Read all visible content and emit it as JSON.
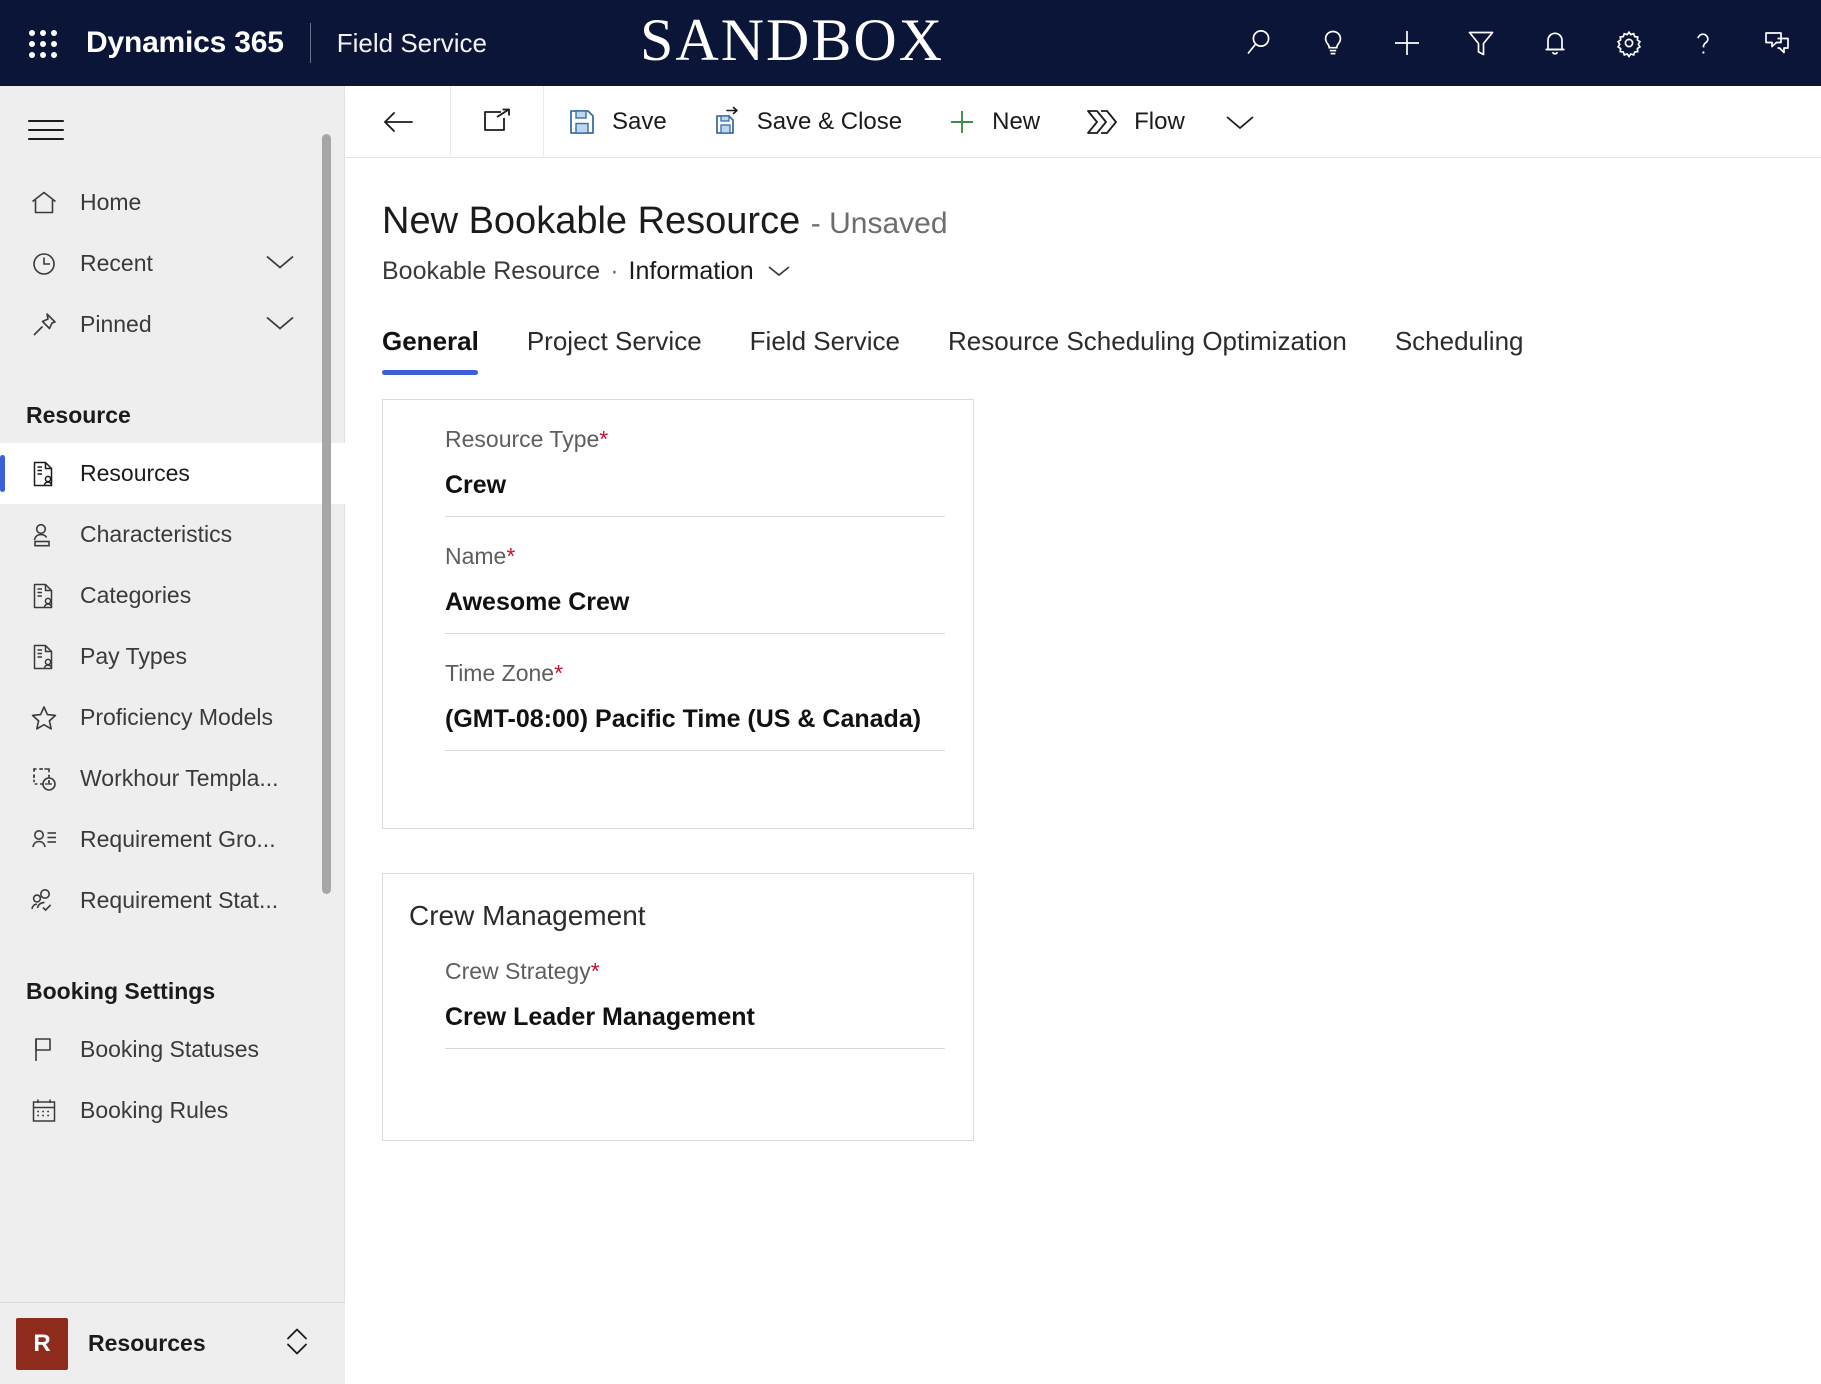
{
  "topbar": {
    "waffle_icon": "app-launcher-icon",
    "brand": "Dynamics 365",
    "app_name": "Field Service",
    "environment_banner": "SANDBOX",
    "icons": [
      {
        "name": "search-icon",
        "label": "Search"
      },
      {
        "name": "lightbulb-icon",
        "label": "Ideas"
      },
      {
        "name": "plus-icon",
        "label": "Quick create"
      },
      {
        "name": "filter-icon",
        "label": "Filter"
      },
      {
        "name": "bell-icon",
        "label": "Notifications"
      },
      {
        "name": "gear-icon",
        "label": "Settings"
      },
      {
        "name": "question-icon",
        "label": "Help"
      },
      {
        "name": "feedback-icon",
        "label": "Feedback"
      }
    ]
  },
  "sidebar": {
    "hamburger_label": "Site map",
    "items": [
      {
        "label": "Home",
        "icon": "home-icon",
        "chevron": false,
        "selected": false
      },
      {
        "label": "Recent",
        "icon": "clock-icon",
        "chevron": true,
        "selected": false
      },
      {
        "label": "Pinned",
        "icon": "pin-icon",
        "chevron": true,
        "selected": false
      }
    ],
    "groups": [
      {
        "header": "Resource",
        "items": [
          {
            "label": "Resources",
            "icon": "resource-card-icon",
            "selected": true
          },
          {
            "label": "Characteristics",
            "icon": "person-line-icon",
            "selected": false
          },
          {
            "label": "Categories",
            "icon": "resource-card-icon",
            "selected": false
          },
          {
            "label": "Pay Types",
            "icon": "resource-card-icon",
            "selected": false
          },
          {
            "label": "Proficiency Models",
            "icon": "star-icon",
            "selected": false
          },
          {
            "label": "Workhour Templa...",
            "icon": "workhour-clock-icon",
            "selected": false
          },
          {
            "label": "Requirement Gro...",
            "icon": "person-list-icon",
            "selected": false
          },
          {
            "label": "Requirement Stat...",
            "icon": "people-check-icon",
            "selected": false
          }
        ]
      },
      {
        "header": "Booking Settings",
        "items": [
          {
            "label": "Booking Statuses",
            "icon": "flag-icon",
            "selected": false
          },
          {
            "label": "Booking Rules",
            "icon": "calendar-icon",
            "selected": false
          }
        ]
      }
    ],
    "area_switcher": {
      "badge": "R",
      "label": "Resources",
      "badge_color": "#8f2b1d",
      "chevron_icon": "chevron-up-down-icon"
    }
  },
  "command_bar": {
    "back_label": "Back",
    "popout_label": "Open in new window",
    "buttons": [
      {
        "label": "Save",
        "icon": "save-floppy-icon"
      },
      {
        "label": "Save & Close",
        "icon": "save-close-icon"
      },
      {
        "label": "New",
        "icon": "plus-green-icon"
      },
      {
        "label": "Flow",
        "icon": "flow-icon"
      }
    ],
    "overflow_label": "More commands",
    "overflow_icon": "chevron-down-icon"
  },
  "form": {
    "title": "New Bookable Resource",
    "title_status": "- Unsaved",
    "breadcrumb_entity": "Bookable Resource",
    "breadcrumb_separator": "·",
    "breadcrumb_form": "Information",
    "breadcrumb_chevron": "chevron-down-icon",
    "tabs": [
      {
        "label": "General",
        "active": true
      },
      {
        "label": "Project Service",
        "active": false
      },
      {
        "label": "Field Service",
        "active": false
      },
      {
        "label": "Resource Scheduling Optimization",
        "active": false
      },
      {
        "label": "Scheduling",
        "active": false
      }
    ],
    "sections": [
      {
        "title": "",
        "fields": [
          {
            "label": "Resource Type",
            "required": true,
            "value": "Crew"
          },
          {
            "label": "Name",
            "required": true,
            "value": "Awesome Crew"
          },
          {
            "label": "Time Zone",
            "required": true,
            "value": "(GMT-08:00) Pacific Time (US & Canada)"
          }
        ]
      },
      {
        "title": "Crew Management",
        "fields": [
          {
            "label": "Crew Strategy",
            "required": true,
            "value": "Crew Leader Management"
          }
        ]
      }
    ]
  },
  "colors": {
    "nav_background": "#0b1537",
    "accent": "#3a5fd9",
    "required_asterisk": "#c4122f",
    "save_icon": "#3a6ea8",
    "new_icon": "#3e8a4f",
    "sidebar_background": "#eeeeee"
  }
}
